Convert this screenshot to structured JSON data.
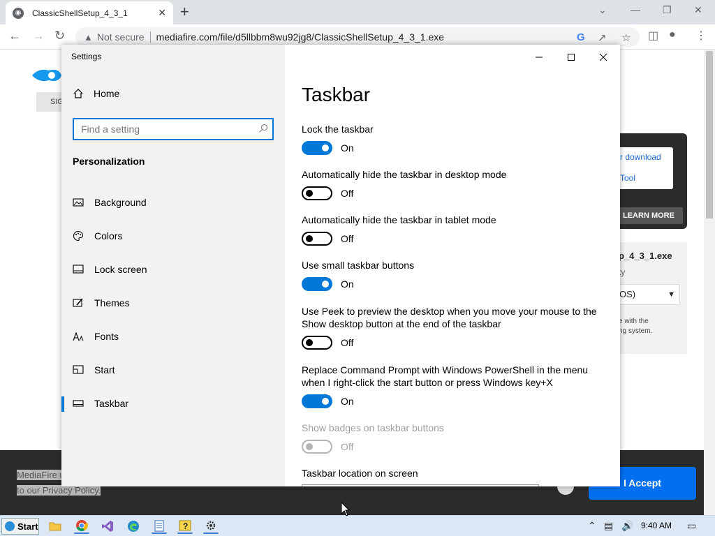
{
  "browser": {
    "tab_title": "ClassicShellSetup_4_3_1",
    "new_tab": "+",
    "security_label": "Not secure",
    "url": "mediafire.com/file/d5llbbm8wu92jg8/ClassicShellSetup_4_3_1.exe"
  },
  "background_page": {
    "sign_in": "SIG",
    "promo_link_1": "r download",
    "promo_link_2": "Tool",
    "learn_more": "LEARN MORE",
    "file_name": "p_4_3_1.exe",
    "file_type": "ty",
    "os_select": "OS)",
    "note_line_1": "e with the",
    "note_line_2": "ng system.",
    "cookie_line_1": "MediaFire u",
    "cookie_line_2": "to our Privacy Policy.",
    "accept_button": "I Accept"
  },
  "settings": {
    "window_title": "Settings",
    "sidebar": {
      "home": "Home",
      "search_placeholder": "Find a setting",
      "section": "Personalization",
      "items": [
        {
          "label": "Background",
          "icon": "picture-icon"
        },
        {
          "label": "Colors",
          "icon": "palette-icon"
        },
        {
          "label": "Lock screen",
          "icon": "lock-screen-icon"
        },
        {
          "label": "Themes",
          "icon": "themes-icon"
        },
        {
          "label": "Fonts",
          "icon": "fonts-icon"
        },
        {
          "label": "Start",
          "icon": "start-icon"
        },
        {
          "label": "Taskbar",
          "icon": "taskbar-icon",
          "selected": true
        }
      ]
    },
    "page_title": "Taskbar",
    "options": [
      {
        "label": "Lock the taskbar",
        "state": "On"
      },
      {
        "label": "Automatically hide the taskbar in desktop mode",
        "state": "Off"
      },
      {
        "label": "Automatically hide the taskbar in tablet mode",
        "state": "Off"
      },
      {
        "label": "Use small taskbar buttons",
        "state": "On"
      },
      {
        "label": "Use Peek to preview the desktop when you move your mouse to the Show desktop button at the end of the taskbar",
        "state": "Off"
      },
      {
        "label": "Replace Command Prompt with Windows PowerShell in the menu when I right-click the start button or press Windows key+X",
        "state": "On"
      },
      {
        "label": "Show badges on taskbar buttons",
        "state": "Off",
        "disabled": true
      }
    ],
    "location_label": "Taskbar location on screen"
  },
  "taskbar": {
    "start": "Start",
    "time": "9:40 AM"
  },
  "colors": {
    "accent": "#0078d7",
    "accept_button": "#0070f0"
  }
}
